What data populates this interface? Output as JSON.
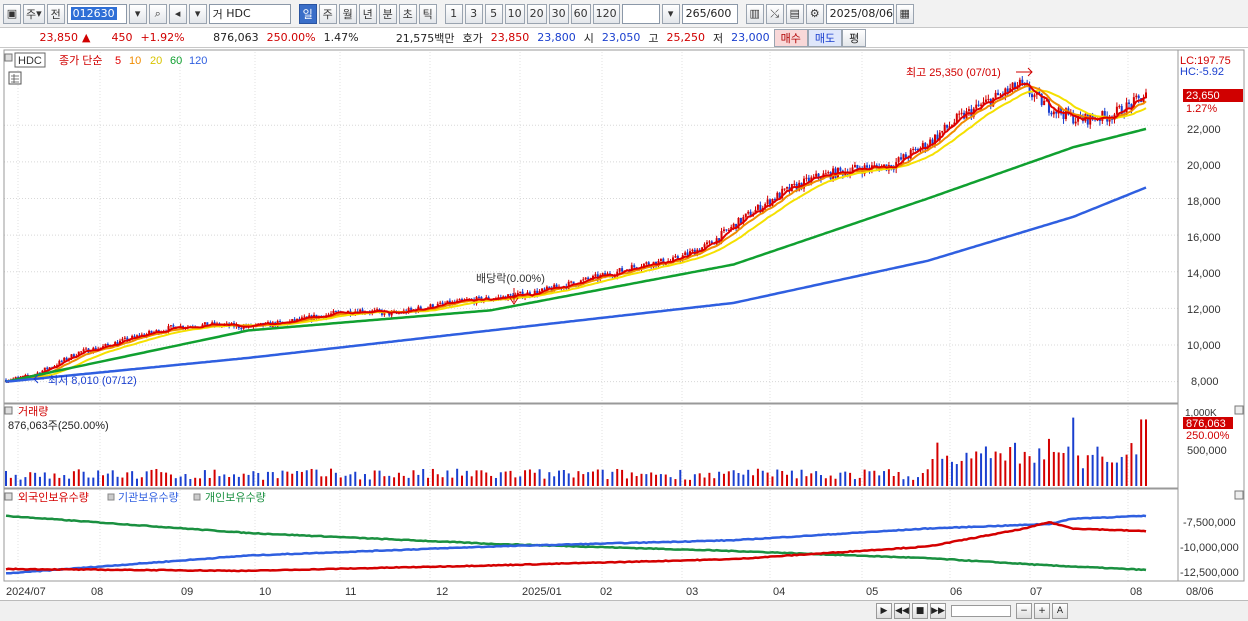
{
  "toolbar": {
    "period_label": "주",
    "prev_label": "전",
    "stock_code": "012630",
    "stock_name_prefix": "거",
    "stock_name": "HDC",
    "intervals": [
      "일",
      "주",
      "월",
      "년",
      "분",
      "초",
      "틱"
    ],
    "active_interval": "일",
    "numbers": [
      "1",
      "3",
      "5",
      "10",
      "20",
      "30",
      "60",
      "120"
    ],
    "count": "265",
    "count_max": "/600",
    "date": "2025/08/06"
  },
  "quote": {
    "price": "23,850",
    "change": "450",
    "change_pct": "+1.92%",
    "volume": "876,063",
    "volume_ratio": "250.00%",
    "turnover_pct": "1.47%",
    "amount": "21,575백만",
    "hoga_label": "호가",
    "ask": "23,850",
    "bid": "23,800",
    "open_label": "시",
    "open": "23,050",
    "high_label": "고",
    "high": "25,250",
    "low_label": "저",
    "low": "23,000",
    "buy_label": "매수",
    "sell_label": "매도",
    "avg_label": "평"
  },
  "price_panel": {
    "tag": "HDC",
    "legend_title": "종가 단순",
    "ma_periods": [
      "5",
      "10",
      "20",
      "60",
      "120"
    ],
    "ma_colors": [
      "#e00000",
      "#f08c00",
      "#f5e000",
      "#10a030",
      "#2f5fe0"
    ],
    "lc": "LC:197.75",
    "hc": "HC:-5.92",
    "current_tag": "23,650",
    "current_pct": "1.27%",
    "y_ticks": [
      "22,000",
      "20,000",
      "18,000",
      "16,000",
      "14,000",
      "12,000",
      "10,000",
      "8,000"
    ],
    "high_note": "최고 25,350 (07/01)",
    "low_note": "최저 8,010 (07/12)",
    "dividend_note": "배당락(0.00%)"
  },
  "volume_panel": {
    "title": "거래량",
    "value_label": "876,063주(250.00%)",
    "tag_max": "1,000K",
    "tag_value": "876,063",
    "tag_pct": "250.00%",
    "y_ticks": [
      "500,000"
    ]
  },
  "holder_panel": {
    "legend": [
      "외국인보유수량",
      "기관보유수량",
      "개인보유수량"
    ],
    "colors": [
      "#d40000",
      "#2f5fe0",
      "#1a9040"
    ],
    "y_ticks": [
      "-7,500,000",
      "-10,000,000",
      "-12,500,000"
    ]
  },
  "x_axis": {
    "labels": [
      "2024/07",
      "08",
      "09",
      "10",
      "11",
      "12",
      "2025/01",
      "02",
      "03",
      "04",
      "05",
      "06",
      "07",
      "08",
      "08/06"
    ]
  },
  "chart_data": {
    "type": "candlestick",
    "x_range": [
      "2024/07",
      "2025/08/06"
    ],
    "price_ylim": [
      7000,
      26000
    ],
    "price_path": [
      [
        0,
        8100
      ],
      [
        10,
        8300
      ],
      [
        20,
        8900
      ],
      [
        30,
        9600
      ],
      [
        40,
        9900
      ],
      [
        55,
        10500
      ],
      [
        70,
        11000
      ],
      [
        85,
        11100
      ],
      [
        100,
        11000
      ],
      [
        115,
        11200
      ],
      [
        130,
        11600
      ],
      [
        145,
        11900
      ],
      [
        160,
        11700
      ],
      [
        175,
        12100
      ],
      [
        190,
        12400
      ],
      [
        205,
        12600
      ],
      [
        220,
        12900
      ],
      [
        235,
        13400
      ],
      [
        250,
        13900
      ],
      [
        262,
        14400
      ],
      [
        275,
        14600
      ],
      [
        290,
        15500
      ],
      [
        305,
        17000
      ],
      [
        320,
        18300
      ],
      [
        335,
        19200
      ],
      [
        350,
        19600
      ],
      [
        365,
        19800
      ],
      [
        380,
        21000
      ],
      [
        392,
        22300
      ],
      [
        405,
        23300
      ],
      [
        418,
        24200
      ],
      [
        430,
        23000
      ],
      [
        442,
        22300
      ],
      [
        455,
        22500
      ],
      [
        465,
        23200
      ],
      [
        470,
        23650
      ]
    ],
    "ma60": [
      [
        0,
        8000
      ],
      [
        100,
        10800
      ],
      [
        200,
        11900
      ],
      [
        300,
        14400
      ],
      [
        380,
        18000
      ],
      [
        440,
        20800
      ],
      [
        470,
        21800
      ]
    ],
    "ma120": [
      [
        0,
        8000
      ],
      [
        100,
        9300
      ],
      [
        200,
        10800
      ],
      [
        300,
        12300
      ],
      [
        380,
        14600
      ],
      [
        440,
        17000
      ],
      [
        470,
        18600
      ]
    ],
    "volume_max": 1000000,
    "current_volume": 876063,
    "holder_ylim": [
      -13500000,
      -5500000
    ],
    "foreign_path": [
      [
        0,
        -12500000
      ],
      [
        100,
        -12700000
      ],
      [
        200,
        -12100000
      ],
      [
        300,
        -11400000
      ],
      [
        380,
        -10000000
      ],
      [
        420,
        -8000000
      ],
      [
        430,
        -7300000
      ],
      [
        440,
        -8000000
      ],
      [
        470,
        -8300000
      ]
    ],
    "institution_path": [
      [
        0,
        -13000000
      ],
      [
        100,
        -11000000
      ],
      [
        200,
        -10000000
      ],
      [
        300,
        -9300000
      ],
      [
        380,
        -8000000
      ],
      [
        430,
        -7500000
      ],
      [
        440,
        -6900000
      ],
      [
        470,
        -6600000
      ]
    ],
    "individual_path": [
      [
        0,
        -6600000
      ],
      [
        100,
        -8500000
      ],
      [
        200,
        -9700000
      ],
      [
        300,
        -10500000
      ],
      [
        380,
        -11300000
      ],
      [
        430,
        -12100000
      ],
      [
        470,
        -12600000
      ]
    ]
  }
}
